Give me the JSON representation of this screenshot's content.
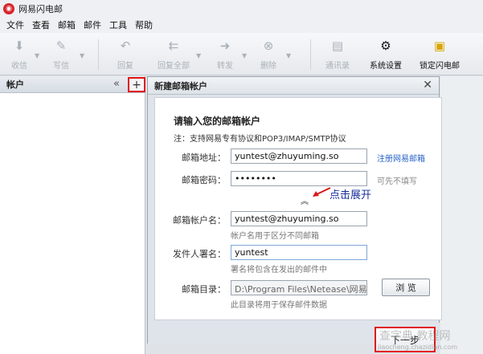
{
  "window": {
    "title": "网易闪电邮"
  },
  "menu": [
    "文件",
    "查看",
    "邮箱",
    "邮件",
    "工具",
    "帮助"
  ],
  "toolbar": {
    "receive": "收信",
    "compose": "写信",
    "reply": "回复",
    "reply_all": "回复全部",
    "forward": "转发",
    "delete": "删除",
    "contacts": "通讯录",
    "settings": "系统设置",
    "lock": "锁定闪电邮"
  },
  "sidebar": {
    "title": "帐户",
    "collapse": "«",
    "add": "+"
  },
  "dialog": {
    "title": "新建邮箱帐户",
    "close": "✕",
    "heading": "请输入您的邮箱帐户",
    "note": "注：支持网易专有协议和POP3/IMAP/SMTP协议",
    "email_label": "邮箱地址：",
    "email_value": "yuntest@zhuyuming.so",
    "register_link": "注册网易邮箱",
    "password_label": "邮箱密码：",
    "password_value": "••••••••",
    "password_hint": "可先不填写",
    "expand": "︽",
    "account_label": "邮箱帐户名：",
    "account_value": "yuntest@zhuyuming.so",
    "account_hint": "帐户名用于区分不同邮箱",
    "sender_label": "发件人署名：",
    "sender_value": "yuntest",
    "sender_hint": "署名将包含在发出的邮件中",
    "dir_label": "邮箱目录：",
    "dir_value": "D:\\Program Files\\Netease\\网易闪",
    "dir_hint": "此目录将用于保存邮件数据",
    "browse": "浏 览",
    "next": "下一步"
  },
  "annotation": "点击展开",
  "watermark": {
    "main": "查字典 教程网",
    "sub": "jiaocheng.chazidian.com"
  },
  "colors": {
    "highlight_red": "#e01414",
    "annotation_blue": "#1a2f9e",
    "link_blue": "#2a64c8"
  }
}
